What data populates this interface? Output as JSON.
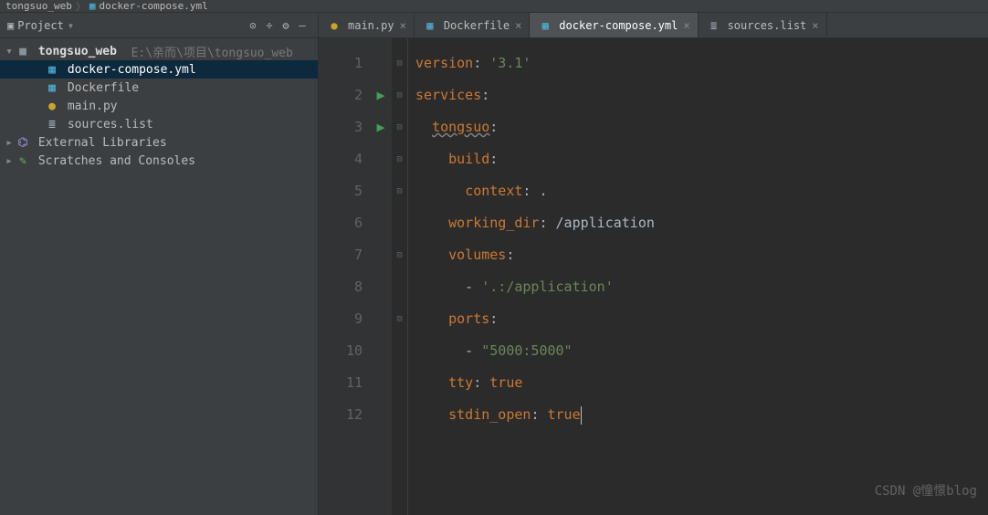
{
  "breadcrumb": {
    "project": "tongsuo_web",
    "file": "docker-compose.yml"
  },
  "sidebar": {
    "title": "Project",
    "root": {
      "name": "tongsuo_web",
      "path": "E:\\亲而\\项目\\tongsuo_web"
    },
    "files": [
      {
        "name": "docker-compose.yml",
        "icon": "yaml",
        "selected": true
      },
      {
        "name": "Dockerfile",
        "icon": "docker",
        "selected": false
      },
      {
        "name": "main.py",
        "icon": "python",
        "selected": false
      },
      {
        "name": "sources.list",
        "icon": "text",
        "selected": false
      }
    ],
    "extras": [
      {
        "name": "External Libraries",
        "icon": "lib"
      },
      {
        "name": "Scratches and Consoles",
        "icon": "scratch"
      }
    ]
  },
  "tabs": [
    {
      "label": "main.py",
      "icon": "python",
      "active": false
    },
    {
      "label": "Dockerfile",
      "icon": "docker",
      "active": false
    },
    {
      "label": "docker-compose.yml",
      "icon": "yaml",
      "active": true
    },
    {
      "label": "sources.list",
      "icon": "text",
      "active": false
    }
  ],
  "editor": {
    "lines": [
      [
        {
          "t": "version",
          "c": "k-key"
        },
        {
          "t": ": ",
          "c": "k-plain"
        },
        {
          "t": "'3.1'",
          "c": "k-str"
        }
      ],
      [
        {
          "t": "services",
          "c": "k-key"
        },
        {
          "t": ":",
          "c": "k-plain"
        }
      ],
      [
        {
          "t": "  ",
          "c": "k-plain"
        },
        {
          "t": "tongsuo",
          "c": "k-key underline-wavy"
        },
        {
          "t": ":",
          "c": "k-plain"
        }
      ],
      [
        {
          "t": "    ",
          "c": "k-plain"
        },
        {
          "t": "build",
          "c": "k-key"
        },
        {
          "t": ":",
          "c": "k-plain"
        }
      ],
      [
        {
          "t": "      ",
          "c": "k-plain"
        },
        {
          "t": "context",
          "c": "k-key"
        },
        {
          "t": ": .",
          "c": "k-plain"
        }
      ],
      [
        {
          "t": "    ",
          "c": "k-plain"
        },
        {
          "t": "working_dir",
          "c": "k-key"
        },
        {
          "t": ": /application",
          "c": "k-plain"
        }
      ],
      [
        {
          "t": "    ",
          "c": "k-plain"
        },
        {
          "t": "volumes",
          "c": "k-key"
        },
        {
          "t": ":",
          "c": "k-plain"
        }
      ],
      [
        {
          "t": "      - ",
          "c": "k-plain"
        },
        {
          "t": "'.:/application'",
          "c": "k-str"
        }
      ],
      [
        {
          "t": "    ",
          "c": "k-plain"
        },
        {
          "t": "ports",
          "c": "k-key"
        },
        {
          "t": ":",
          "c": "k-plain"
        }
      ],
      [
        {
          "t": "      - ",
          "c": "k-plain"
        },
        {
          "t": "\"5000:5000\"",
          "c": "k-str"
        }
      ],
      [
        {
          "t": "    ",
          "c": "k-plain"
        },
        {
          "t": "tty",
          "c": "k-key"
        },
        {
          "t": ": ",
          "c": "k-plain"
        },
        {
          "t": "true",
          "c": "k-word"
        }
      ],
      [
        {
          "t": "    ",
          "c": "k-plain"
        },
        {
          "t": "stdin_open",
          "c": "k-key"
        },
        {
          "t": ": ",
          "c": "k-plain"
        },
        {
          "t": "true",
          "c": "k-word"
        },
        {
          "t": "",
          "c": "cursor"
        }
      ]
    ],
    "run_gutter": {
      "2": true,
      "3": true
    }
  },
  "watermark": "CSDN @憧憬blog"
}
